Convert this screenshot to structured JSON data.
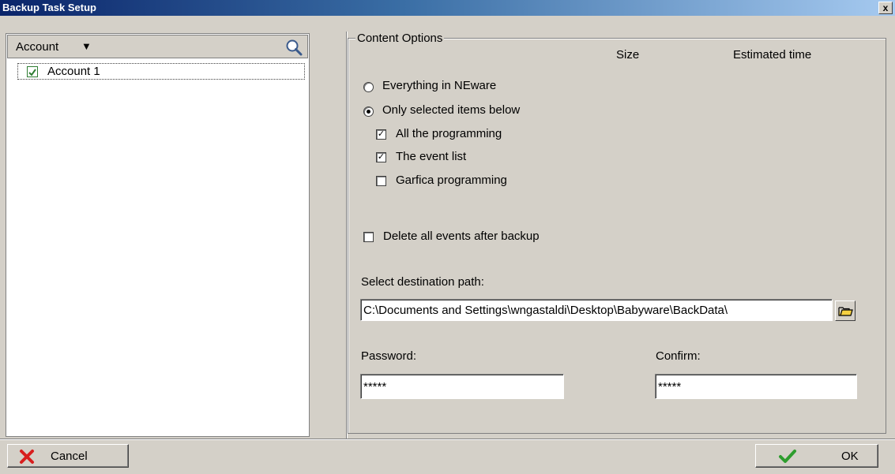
{
  "window": {
    "title": "Backup Task Setup",
    "close_label": "x"
  },
  "accounts": {
    "header_label": "Account",
    "header_arrow": "▼",
    "items": [
      {
        "label": "Account 1",
        "checked": true
      }
    ]
  },
  "content_options": {
    "legend": "Content Options",
    "col_size": "Size",
    "col_time": "Estimated time",
    "radio_all": "Everything in NEware",
    "radio_selected": "Only selected items below",
    "check_programming": "All the programming",
    "check_events": "The event list",
    "check_garfica": "Garfica programming",
    "delete_events": "Delete all events after backup",
    "dest_label": "Select destination path:",
    "dest_value": "C:\\Documents and Settings\\wngastaldi\\Desktop\\Babyware\\BackData\\",
    "password_label": "Password:",
    "password_value": "*****",
    "confirm_label": "Confirm:",
    "confirm_value": "*****"
  },
  "buttons": {
    "cancel": "Cancel",
    "ok": "OK"
  },
  "icons": {
    "search": "search-icon",
    "folder": "folder-icon",
    "cancel": "red-x-icon",
    "ok": "green-check-icon"
  }
}
